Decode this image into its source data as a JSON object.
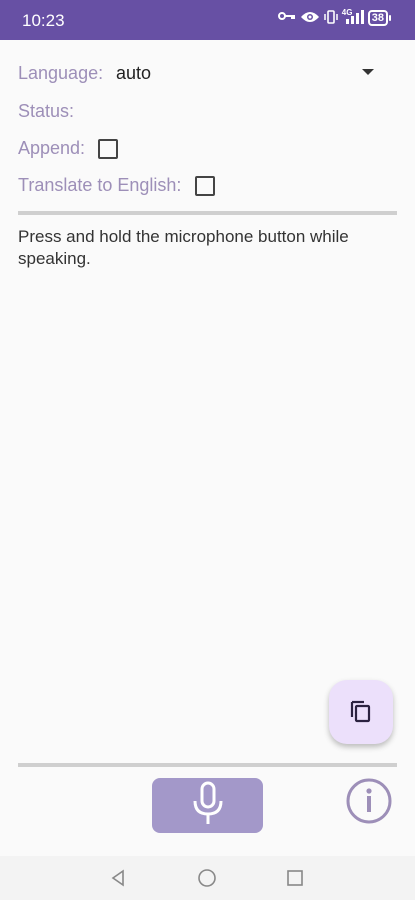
{
  "status_bar": {
    "time": "10:23",
    "network": "4G",
    "battery": "38",
    "icons": [
      "key-icon",
      "eye-icon",
      "vibrate-icon",
      "signal-icon",
      "battery-icon"
    ]
  },
  "form": {
    "language_label": "Language:",
    "language_value": "auto",
    "status_label": "Status:",
    "status_value": "",
    "append_label": "Append:",
    "append_checked": false,
    "translate_label": "Translate to English:",
    "translate_checked": false
  },
  "output": {
    "text": "Press and hold the microphone button while speaking."
  },
  "colors": {
    "primary": "#6750a4",
    "label": "#9d8fb8",
    "mic_button": "#a398c9",
    "fab": "#ece0fb"
  }
}
